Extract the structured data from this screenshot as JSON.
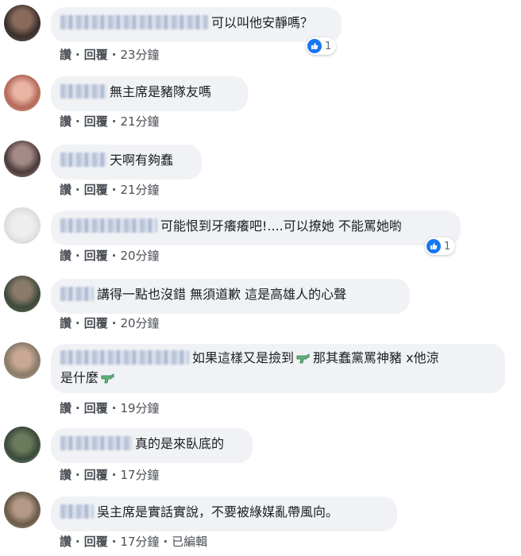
{
  "comments": [
    {
      "text": "可以叫他安靜嗎？",
      "actions": {
        "like": "讚",
        "reply": "回覆",
        "time": "23分鐘"
      },
      "reaction": {
        "icon": "like-icon",
        "count": "1"
      }
    },
    {
      "text": "無主席是豬隊友嗎",
      "actions": {
        "like": "讚",
        "reply": "回覆",
        "time": "21分鐘"
      }
    },
    {
      "text": "天啊有夠蠢",
      "actions": {
        "like": "讚",
        "reply": "回覆",
        "time": "21分鐘"
      }
    },
    {
      "text": "可能恨到牙癢癢吧!....可以撩她 不能罵她喲",
      "actions": {
        "like": "讚",
        "reply": "回覆",
        "time": "20分鐘"
      },
      "reaction": {
        "icon": "like-icon",
        "count": "1"
      }
    },
    {
      "text": "講得一點也沒錯 無須道歉 這是高雄人的心聲",
      "actions": {
        "like": "讚",
        "reply": "回覆",
        "time": "20分鐘"
      }
    },
    {
      "text_a": "如果這樣又是撿到",
      "text_b": "那其蠢黨罵神豬 x他涼",
      "text_c": "是什麼",
      "actions": {
        "like": "讚",
        "reply": "回覆",
        "time": "19分鐘"
      }
    },
    {
      "text": "真的是來臥底的",
      "actions": {
        "like": "讚",
        "reply": "回覆",
        "time": "17分鐘"
      }
    },
    {
      "text": "吳主席是實話實說，不要被綠媒亂帶風向。",
      "actions": {
        "like": "讚",
        "reply": "回覆",
        "time": "17分鐘",
        "edited": "已編輯"
      }
    }
  ],
  "colors": {
    "bubble": "#f0f2f5",
    "action_text": "#4b4f56",
    "like_blue": "#1877f2"
  }
}
